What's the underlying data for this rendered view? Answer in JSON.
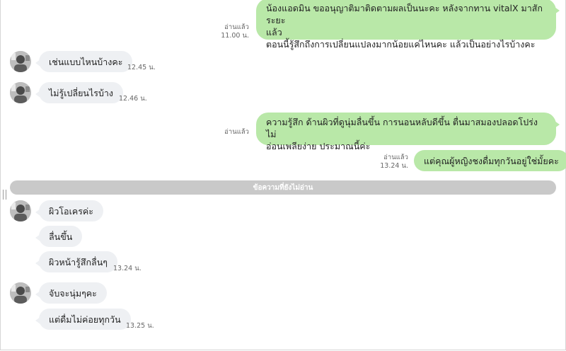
{
  "divider": {
    "label": "ข้อความที่ยังไม่อ่าน"
  },
  "messages": {
    "m1": {
      "lines": [
        "น้องแอดมิน ขออนุญาติมาติดตามผลเป็นนะคะ หลังจากทาน vitalX มาสักระยะ",
        "แล้ว",
        "ตอนนี้รู้สึกถึงการเปลี่ยนแปลงมากน้อยแค่ไหนคะ แล้วเป็นอย่างไรบ้างคะ"
      ],
      "read": "อ่านแล้ว",
      "time": "11.00 น."
    },
    "m2": {
      "text": "เช่นแบบไหนบ้างคะ",
      "time": "12.45 น."
    },
    "m3": {
      "text": "ไม่รู้เปลี่ยนไรบ้าง",
      "time": "12.46 น."
    },
    "m4": {
      "lines": [
        "ความรู้สึก ด้านผิวที่ดูนุ่มลื่นขึ้น การนอนหลับดีขึ้น ตื่นมาสมองปลอดโปร่ง ไม่",
        "อ่อนเพลียง่าย ประมาณนี้ค่ะ"
      ],
      "read": "อ่านแล้ว"
    },
    "m5": {
      "text": "แต่คุณผู้หญิงชงดื่มทุกวันอยู่ใช่มั้ยคะ",
      "read": "อ่านแล้ว",
      "time": "13.24 น."
    },
    "m6": {
      "text": "ผิวโอเครค่ะ"
    },
    "m7": {
      "text": "ลื่นขึ้น"
    },
    "m8": {
      "text": "ผิวหน้ารู้สึกลื่นๆ",
      "time": "13.24 น."
    },
    "m9": {
      "text": "จับจะนุ่มๆคะ"
    },
    "m10": {
      "text": "แต่ดื่มไม่ค่อยทุกวัน",
      "time": "13.25 น."
    }
  },
  "colors": {
    "outgoing_bubble": "#b9e8a8",
    "incoming_bubble": "#eef0f3",
    "divider": "#c9c9c9"
  }
}
